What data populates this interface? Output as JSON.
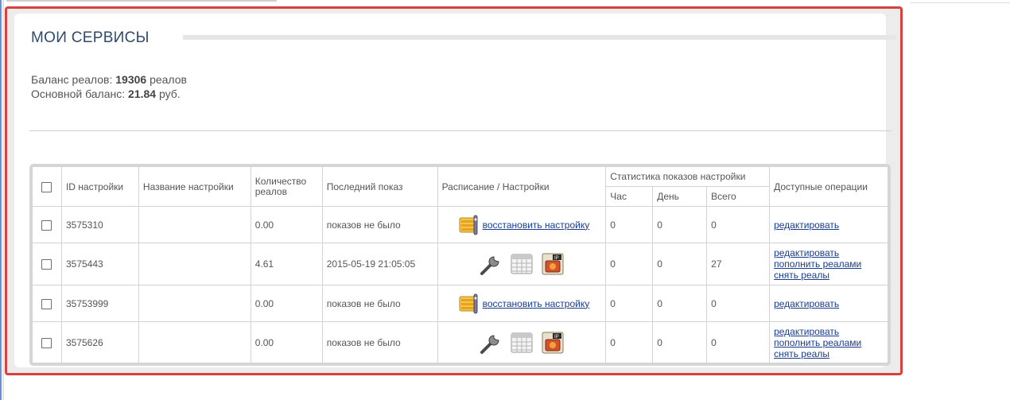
{
  "page": {
    "title": "МОИ СЕРВИСЫ",
    "balance_reals_label": "Баланс реалов:",
    "balance_reals_value": "19306",
    "balance_reals_unit": "реалов",
    "balance_main_label": "Основной баланс:",
    "balance_main_value": "21.84",
    "balance_main_unit": "руб."
  },
  "table": {
    "headers": {
      "id": "ID настройки",
      "name": "Название настройки",
      "reals": "Количество реалов",
      "last": "Последний показ",
      "schedule": "Расписание / Настройки",
      "stats": "Статистика показов настройки",
      "hour": "Час",
      "day": "День",
      "total": "Всего",
      "ops": "Доступные операции"
    },
    "rows": [
      {
        "id": "3575310",
        "name": "",
        "reals": "0.00",
        "last": "показов не было",
        "restore": "восстановить настройку",
        "hour": "0",
        "day": "0",
        "total": "0",
        "ops": [
          "редактировать"
        ]
      },
      {
        "id": "3575443",
        "name": "",
        "reals": "4.61",
        "last": "2015-05-19 21:05:05",
        "restore": "",
        "hour": "0",
        "day": "0",
        "total": "27",
        "ops": [
          "редактировать",
          "пополнить реалами",
          "снять реалы"
        ]
      },
      {
        "id": "35753999",
        "name": "",
        "reals": "0.00",
        "last": "показов не было",
        "restore": "восстановить настройку",
        "hour": "0",
        "day": "0",
        "total": "0",
        "ops": [
          "редактировать"
        ]
      },
      {
        "id": "3575626",
        "name": "",
        "reals": "0.00",
        "last": "показов не было",
        "restore": "",
        "hour": "0",
        "day": "0",
        "total": "0",
        "ops": [
          "редактировать",
          "пополнить реалами",
          "снять реалы"
        ]
      }
    ]
  }
}
